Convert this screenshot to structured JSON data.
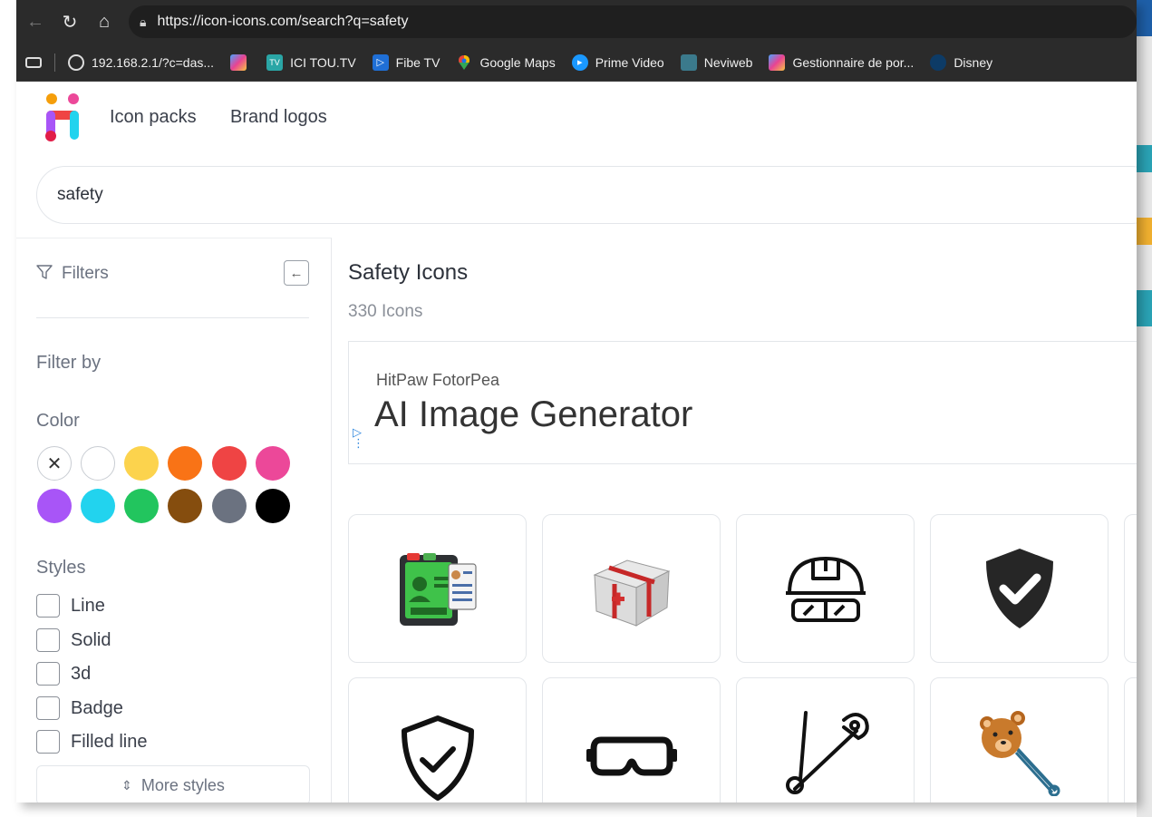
{
  "browser": {
    "url": "https://icon-icons.com/search?q=safety",
    "bookmarks": [
      {
        "label": "192.168.2.1/?c=das...",
        "icon": "globe-icon"
      },
      {
        "label": "",
        "icon": "app-colorful-icon"
      },
      {
        "label": "ICI TOU.TV",
        "icon": "tou-tv-icon"
      },
      {
        "label": "Fibe TV",
        "icon": "play-icon"
      },
      {
        "label": "Google Maps",
        "icon": "map-pin-icon"
      },
      {
        "label": "Prime Video",
        "icon": "prime-video-icon"
      },
      {
        "label": "Neviweb",
        "icon": "neviweb-icon"
      },
      {
        "label": "Gestionnaire de por...",
        "icon": "app-colorful-icon"
      },
      {
        "label": "Disney",
        "icon": "disney-icon"
      }
    ]
  },
  "header": {
    "nav": [
      "Icon packs",
      "Brand logos"
    ]
  },
  "search": {
    "value": "safety"
  },
  "sidebar": {
    "filters_label": "Filters",
    "filter_by_label": "Filter by",
    "color_label": "Color",
    "colors": [
      "#ffffff",
      "#fcd34d",
      "#f97316",
      "#ef4444",
      "#ec4899",
      "#a855f7",
      "#22d3ee",
      "#22c55e",
      "#854d0e",
      "#6b7280",
      "#000000"
    ],
    "styles_label": "Styles",
    "styles": [
      "Line",
      "Solid",
      "3d",
      "Badge",
      "Filled line"
    ],
    "more_styles": "More styles"
  },
  "main": {
    "title": "Safety Icons",
    "count": "330 Icons",
    "ad": {
      "brand": "HitPaw FotorPea",
      "headline": "AI Image Generator"
    },
    "icons": [
      {
        "name": "id-card-badge-icon"
      },
      {
        "name": "first-aid-kit-icon"
      },
      {
        "name": "hard-hat-goggles-icon"
      },
      {
        "name": "shield-check-solid-icon"
      },
      {
        "name": "shield-check-line-icon"
      },
      {
        "name": "safety-goggles-icon"
      },
      {
        "name": "safety-pin-icon"
      },
      {
        "name": "teddy-bear-pin-icon"
      }
    ]
  }
}
